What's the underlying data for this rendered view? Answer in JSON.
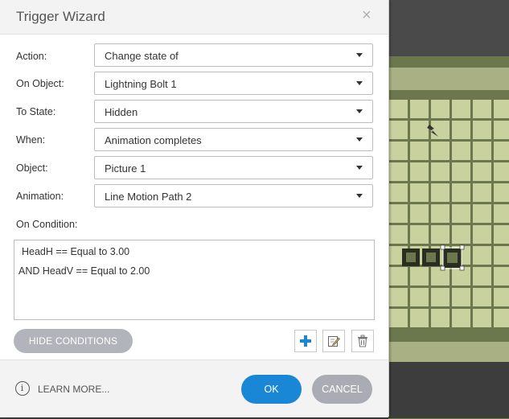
{
  "dialog": {
    "title": "Trigger Wizard",
    "close_glyph": "×"
  },
  "fields": [
    {
      "label": "Action:",
      "value": "Change state of"
    },
    {
      "label": "On Object:",
      "value": "Lightning Bolt 1"
    },
    {
      "label": "To State:",
      "value": "Hidden"
    },
    {
      "label": "When:",
      "value": "Animation completes"
    },
    {
      "label": "Object:",
      "value": "Picture 1"
    },
    {
      "label": "Animation:",
      "value": "Line Motion Path 2"
    }
  ],
  "conditions": {
    "label": "On Condition:",
    "lines": [
      "HeadH == Equal to 3.00",
      "AND HeadV == Equal to 2.00"
    ]
  },
  "buttons": {
    "hide_conditions": "HIDE CONDITIONS",
    "add_icon": "plus-icon",
    "edit_icon": "edit-icon",
    "delete_icon": "trash-icon",
    "learn_more": "LEARN MORE...",
    "ok": "OK",
    "cancel": "CANCEL"
  },
  "colors": {
    "primary_button": "#1a87d6",
    "secondary_button": "#a9adb3",
    "grid_fill": "#c9d19f",
    "grid_band": "#6e7a4f"
  }
}
